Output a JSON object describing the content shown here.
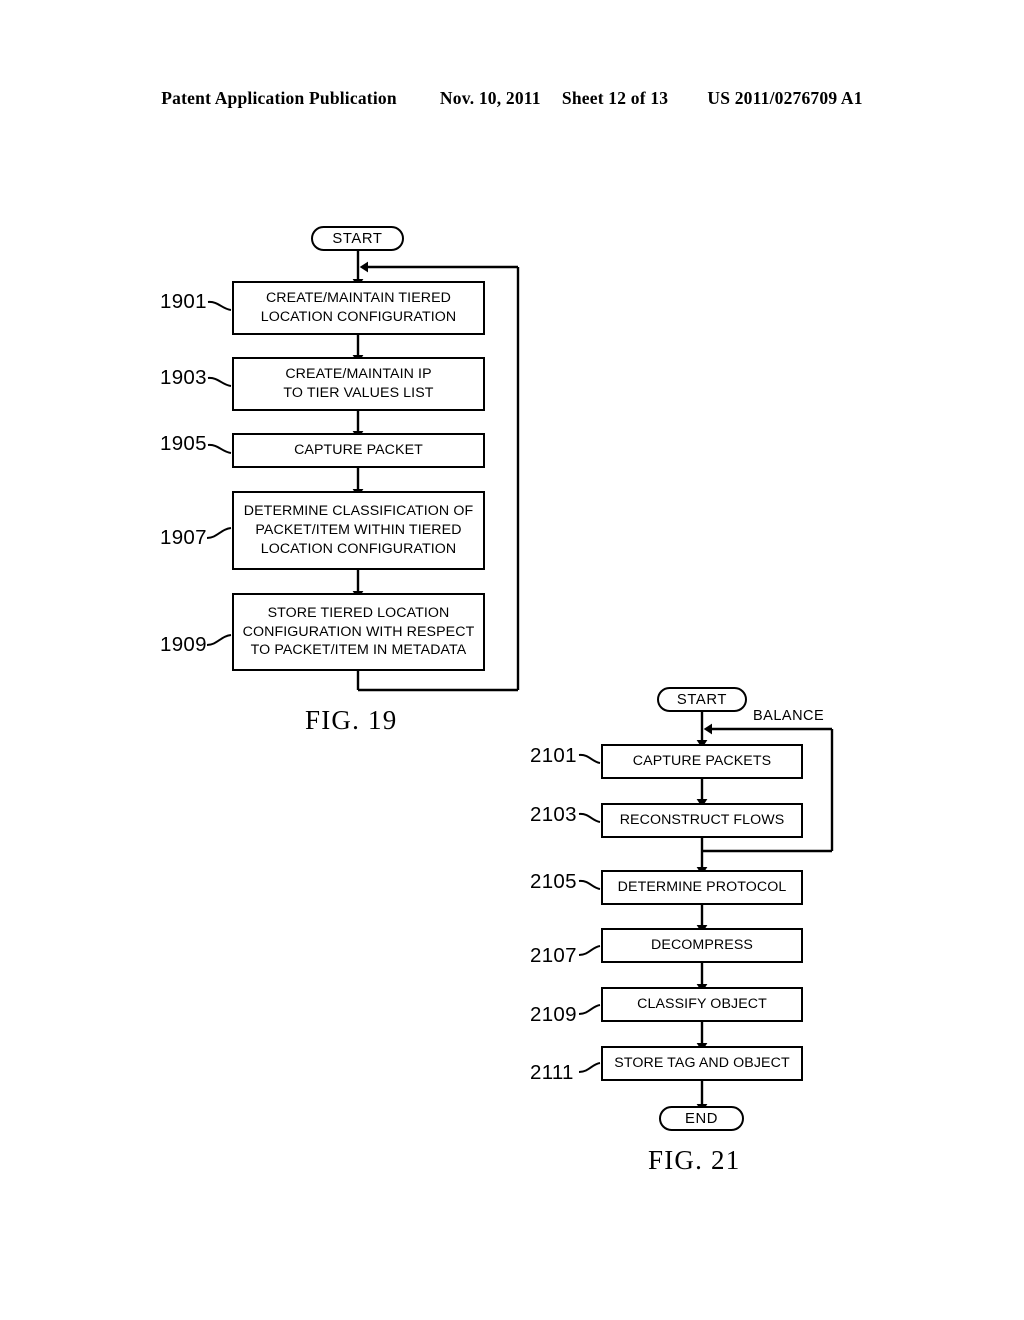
{
  "header": {
    "publication": "Patent Application Publication",
    "date": "Nov. 10, 2011",
    "sheet": "Sheet 12 of 13",
    "docnumber": "US 2011/0276709 A1"
  },
  "figures": [
    {
      "caption": "FIG. 19",
      "start_label": "START",
      "steps": [
        {
          "ref": "1901",
          "text": "CREATE/MAINTAIN TIERED\nLOCATION CONFIGURATION"
        },
        {
          "ref": "1903",
          "text": "CREATE/MAINTAIN IP\nTO TIER VALUES LIST"
        },
        {
          "ref": "1905",
          "text": "CAPTURE PACKET"
        },
        {
          "ref": "1907",
          "text": "DETERMINE CLASSIFICATION OF\nPACKET/ITEM WITHIN TIERED\nLOCATION CONFIGURATION"
        },
        {
          "ref": "1909",
          "text": "STORE TIERED LOCATION\nCONFIGURATION WITH RESPECT\nTO PACKET/ITEM IN METADATA"
        }
      ]
    },
    {
      "caption": "FIG. 21",
      "start_label": "START",
      "end_label": "END",
      "loop_label": "BALANCE",
      "steps": [
        {
          "ref": "2101",
          "text": "CAPTURE PACKETS"
        },
        {
          "ref": "2103",
          "text": "RECONSTRUCT FLOWS"
        },
        {
          "ref": "2105",
          "text": "DETERMINE PROTOCOL"
        },
        {
          "ref": "2107",
          "text": "DECOMPRESS"
        },
        {
          "ref": "2109",
          "text": "CLASSIFY OBJECT"
        },
        {
          "ref": "2111",
          "text": "STORE TAG AND OBJECT"
        }
      ]
    }
  ]
}
